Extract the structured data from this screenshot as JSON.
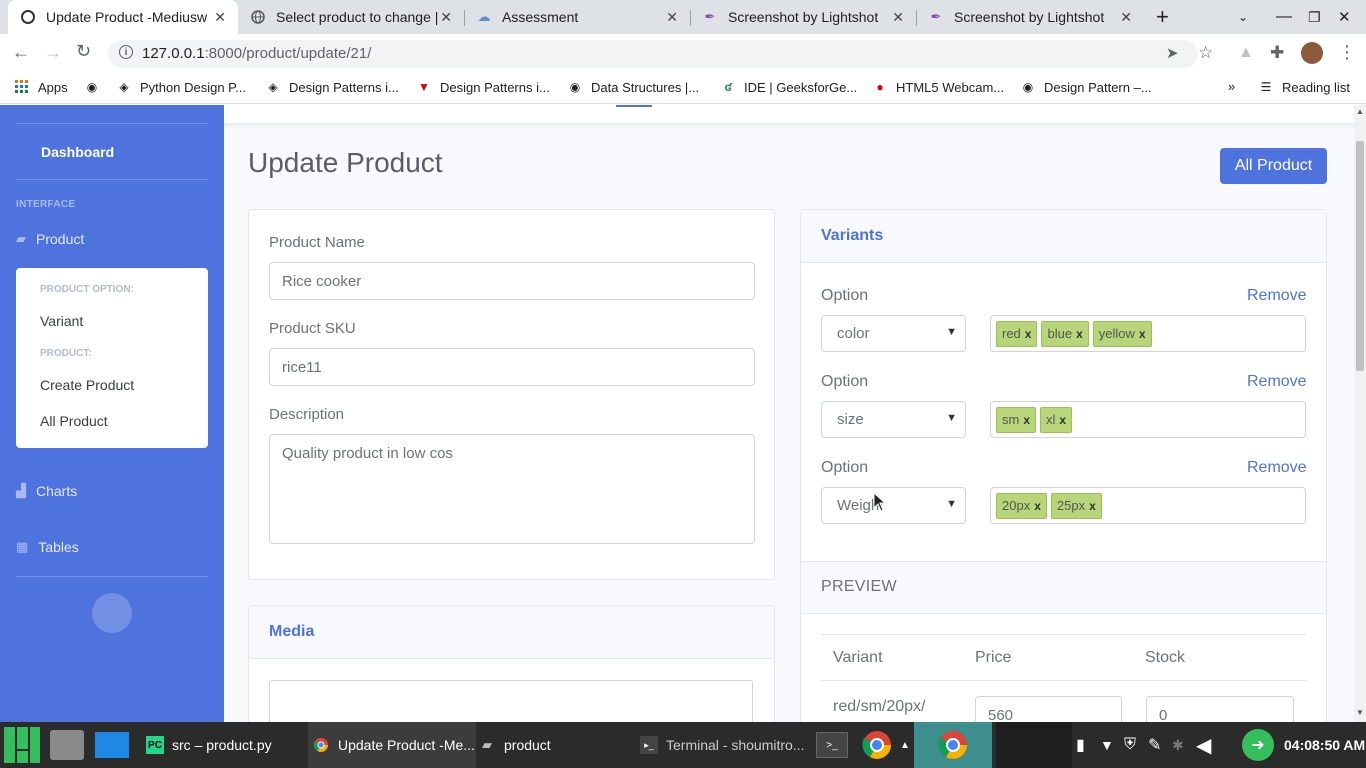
{
  "browser": {
    "tabs": [
      {
        "title": "Update Product -Mediusw",
        "icon": "circle-logo-icon"
      },
      {
        "title": "Select product to change |",
        "icon": "globe-icon"
      },
      {
        "title": "Assessment",
        "icon": "cloud-icon"
      },
      {
        "title": "Screenshot by Lightshot",
        "icon": "feather-icon"
      },
      {
        "title": "Screenshot by Lightshot",
        "icon": "feather-icon"
      }
    ],
    "url_host": "127.0.0.1",
    "url_path": ":8000/product/update/21/",
    "bookmarks": [
      {
        "label": "Apps"
      },
      {
        "label": ""
      },
      {
        "label": "Python Design P..."
      },
      {
        "label": "Design Patterns i..."
      },
      {
        "label": "Design Patterns i..."
      },
      {
        "label": "Data Structures |..."
      },
      {
        "label": "IDE | GeeksforGe..."
      },
      {
        "label": "HTML5 Webcam..."
      },
      {
        "label": "Design Pattern –..."
      }
    ],
    "reading_list": "Reading list"
  },
  "sidebar": {
    "dashboard": "Dashboard",
    "section_interface": "INTERFACE",
    "product": "Product",
    "submenu": {
      "heading_option": "PRODUCT OPTION:",
      "variant": "Variant",
      "heading_product": "PRODUCT:",
      "create_product": "Create Product",
      "all_product": "All Product"
    },
    "charts": "Charts",
    "tables": "Tables"
  },
  "page": {
    "title": "Update Product",
    "all_product_button": "All Product",
    "form": {
      "name_label": "Product Name",
      "name_value": "Rice cooker",
      "sku_label": "Product SKU",
      "sku_value": "rice11",
      "description_label": "Description",
      "description_value": "Quality product in low cos"
    },
    "media_header": "Media",
    "variants": {
      "header": "Variants",
      "option_label": "Option",
      "remove_label": "Remove",
      "options": [
        {
          "selected": "color",
          "tags": [
            "red",
            "blue",
            "yellow"
          ]
        },
        {
          "selected": "size",
          "tags": [
            "sm",
            "xl"
          ]
        },
        {
          "selected": "Weight",
          "tags": [
            "20px",
            "25px"
          ]
        }
      ],
      "tag_remove": "x"
    },
    "preview": {
      "header": "PREVIEW",
      "columns": [
        "Variant",
        "Price",
        "Stock"
      ],
      "rows": [
        {
          "variant": "red/sm/20px/",
          "price": "560",
          "stock": "0"
        }
      ]
    }
  },
  "taskbar": {
    "items": [
      {
        "label": "src – product.py"
      },
      {
        "label": "Update Product -Me..."
      },
      {
        "label": "product"
      },
      {
        "label": "Terminal - shoumitro..."
      }
    ],
    "clock": "04:08:50 AM"
  },
  "colors": {
    "primary": "#4e73df",
    "tag_bg": "#b7d67a",
    "page_bg": "#f8f9fc"
  }
}
